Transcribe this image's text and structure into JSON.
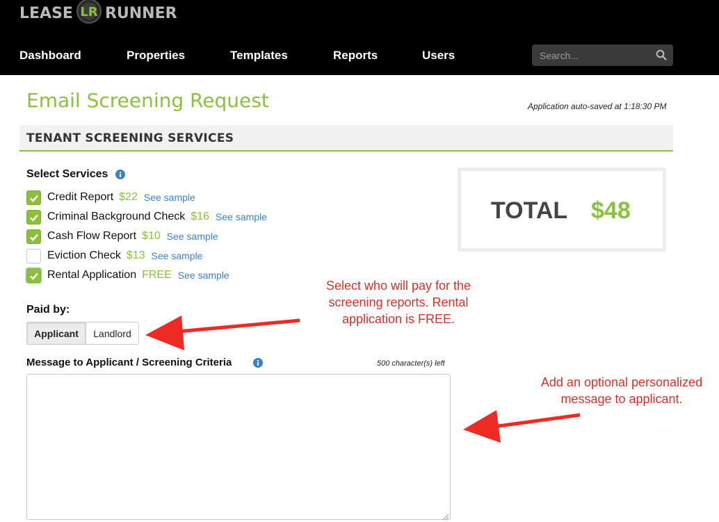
{
  "header": {
    "logo_left": "LEASE",
    "logo_right": "RUNNER",
    "logo_badge": "LR",
    "nav": [
      {
        "label": "Dashboard"
      },
      {
        "label": "Properties"
      },
      {
        "label": "Templates"
      },
      {
        "label": "Reports"
      },
      {
        "label": "Users"
      }
    ],
    "search_placeholder": "Search..."
  },
  "page": {
    "title": "Email Screening Request",
    "autosave": "Application auto-saved at 1:18:30 PM",
    "section": "TENANT SCREENING SERVICES"
  },
  "services": {
    "label": "Select Services",
    "items": [
      {
        "name": "Credit Report",
        "price": "$22",
        "link": "See sample",
        "checked": true
      },
      {
        "name": "Criminal Background Check",
        "price": "$16",
        "link": "See sample",
        "checked": true
      },
      {
        "name": "Cash Flow Report",
        "price": "$10",
        "link": "See sample",
        "checked": true
      },
      {
        "name": "Eviction Check",
        "price": "$13",
        "link": "See sample",
        "checked": false
      },
      {
        "name": "Rental Application",
        "price": "FREE",
        "link": "See sample",
        "checked": true
      }
    ]
  },
  "total": {
    "label": "TOTAL",
    "value": "$48"
  },
  "paid_by": {
    "label": "Paid by:",
    "options": [
      "Applicant",
      "Landlord"
    ],
    "selected": "Applicant"
  },
  "message": {
    "label": "Message to Applicant / Screening Criteria",
    "chars_left": "500 character(s) left",
    "value": ""
  },
  "annotations": {
    "paid_by_note": [
      "Select who will pay for the",
      "screening reports. Rental",
      "application is FREE."
    ],
    "message_note": [
      "Add an optional personalized",
      "message to applicant."
    ]
  },
  "colors": {
    "accent": "#8cbf3f",
    "link": "#3b82c4",
    "annotation": "#d0332c",
    "topbar": "#000000"
  }
}
